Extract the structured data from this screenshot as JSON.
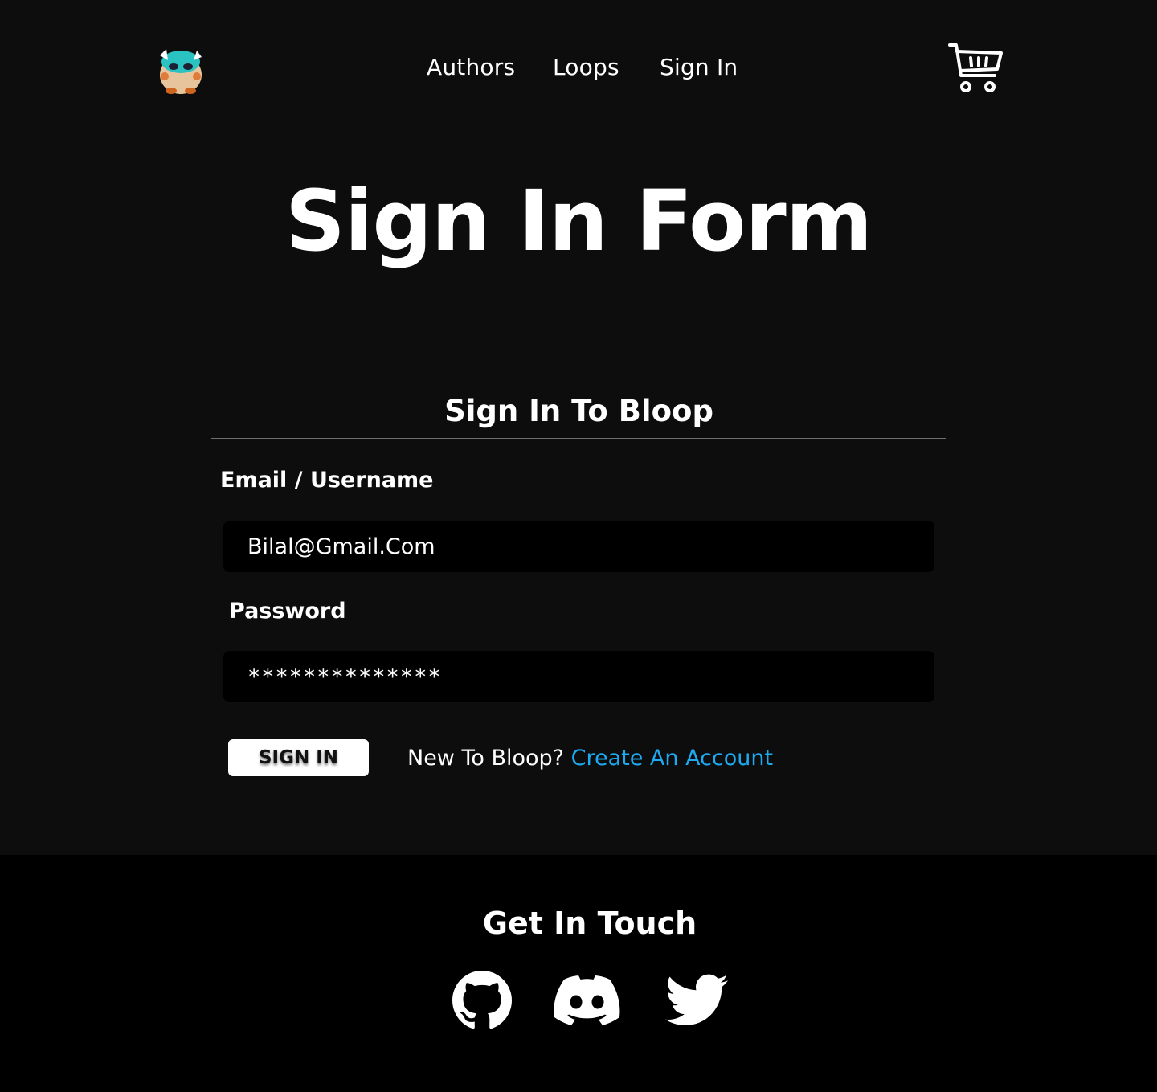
{
  "header": {
    "logo_name": "bloop-mascot-logo",
    "nav": [
      "Authors",
      "Loops",
      "Sign In"
    ],
    "cart_icon": "shopping-cart-icon"
  },
  "page_title": "Sign In Form",
  "form": {
    "heading": "Sign In To Bloop",
    "email_label": "Email / Username",
    "email_value": "Bilal@Gmail.Com",
    "password_label": "Password",
    "password_value": "**************",
    "submit_label": "SIGN IN",
    "signup_prompt": "New To Bloop?",
    "signup_link": "Create An Account"
  },
  "footer": {
    "title": "Get In Touch",
    "icons": [
      "github-icon",
      "discord-icon",
      "twitter-icon"
    ]
  },
  "colors": {
    "background": "#0d0d0d",
    "footer_background": "#000000",
    "text": "#ffffff",
    "link": "#1eaaf1",
    "input_background": "#000000"
  }
}
